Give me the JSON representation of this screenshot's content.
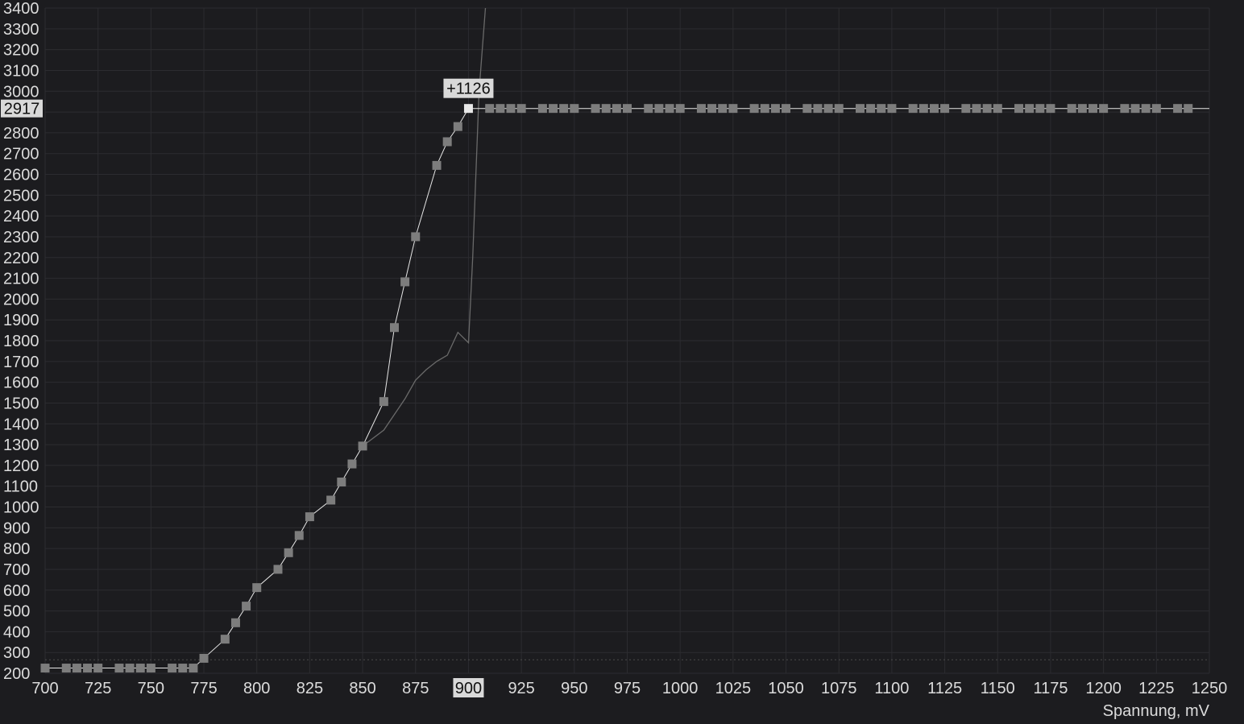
{
  "chart_data": {
    "type": "line",
    "xlabel": "Spannung, mV",
    "ylabel": "",
    "xlim": [
      700,
      1250
    ],
    "ylim": [
      200,
      3400
    ],
    "x_ticks": [
      700,
      725,
      750,
      775,
      800,
      825,
      850,
      875,
      900,
      925,
      950,
      975,
      1000,
      1025,
      1050,
      1075,
      1100,
      1125,
      1150,
      1175,
      1200,
      1225,
      1250
    ],
    "y_ticks": [
      200,
      300,
      400,
      500,
      600,
      700,
      800,
      900,
      1000,
      1100,
      1200,
      1300,
      1400,
      1500,
      1600,
      1700,
      1800,
      1900,
      2000,
      2100,
      2200,
      2300,
      2400,
      2500,
      2600,
      2700,
      2800,
      3000,
      3100,
      3200,
      3300,
      3400
    ],
    "grid": true,
    "colors": {
      "background": "#1c1c1f",
      "grid": "#2c2c30",
      "curve": "#e6e6e6",
      "reference": "#6a6a6a",
      "marker": "#7d7d7d",
      "selected_marker": "#e8e8e8",
      "highlight_box": "#d9d9d9",
      "threshold": "#4a4a4a"
    },
    "threshold_y": 265,
    "selected_point": {
      "x": 900,
      "y": 2917
    },
    "highlight_x_label": "900",
    "highlight_y_label": "2917",
    "annotation": "+1126",
    "series": [
      {
        "role": "curve",
        "x": [
          700,
          710,
          715,
          720,
          725,
          735,
          740,
          745,
          750,
          760,
          765,
          770,
          775,
          785,
          790,
          795,
          800,
          810,
          815,
          820,
          825,
          835,
          840,
          845,
          850,
          860,
          865,
          870,
          875,
          885,
          890,
          895,
          900,
          910,
          915,
          920,
          925,
          935,
          940,
          945,
          950,
          960,
          965,
          970,
          975,
          985,
          990,
          995,
          1000,
          1010,
          1015,
          1020,
          1025,
          1035,
          1040,
          1045,
          1050,
          1060,
          1065,
          1070,
          1075,
          1085,
          1090,
          1095,
          1100,
          1110,
          1115,
          1120,
          1125,
          1135,
          1140,
          1145,
          1150,
          1160,
          1165,
          1170,
          1175,
          1185,
          1190,
          1195,
          1200,
          1210,
          1215,
          1220,
          1225,
          1235,
          1240
        ],
        "y": [
          225,
          225,
          225,
          225,
          225,
          225,
          225,
          225,
          225,
          225,
          225,
          225,
          272,
          364,
          443,
          523,
          612,
          700,
          780,
          863,
          953,
          1033,
          1120,
          1207,
          1293,
          1507,
          1863,
          2083,
          2300,
          2643,
          2757,
          2830,
          2917,
          2917,
          2917,
          2917,
          2917,
          2917,
          2917,
          2917,
          2917,
          2917,
          2917,
          2917,
          2917,
          2917,
          2917,
          2917,
          2917,
          2917,
          2917,
          2917,
          2917,
          2917,
          2917,
          2917,
          2917,
          2917,
          2917,
          2917,
          2917,
          2917,
          2917,
          2917,
          2917,
          2917,
          2917,
          2917,
          2917,
          2917,
          2917,
          2917,
          2917,
          2917,
          2917,
          2917,
          2917,
          2917,
          2917,
          2917,
          2917,
          2917,
          2917,
          2917,
          2917,
          2917,
          2917
        ]
      },
      {
        "role": "reference",
        "x": [
          850,
          860,
          870,
          875,
          880,
          885,
          890,
          895,
          900,
          902,
          905,
          908
        ],
        "y": [
          1293,
          1370,
          1520,
          1610,
          1660,
          1700,
          1730,
          1840,
          1790,
          2200,
          3000,
          3400
        ]
      }
    ]
  }
}
